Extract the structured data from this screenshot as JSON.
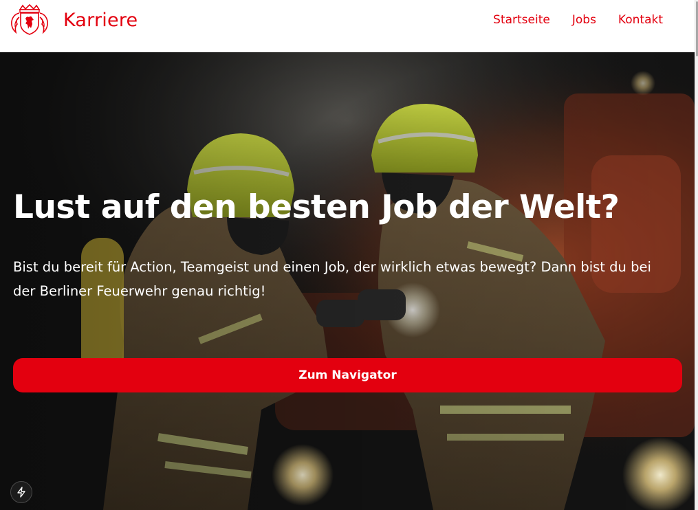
{
  "header": {
    "brand": "Karriere",
    "nav": {
      "home": "Startseite",
      "jobs": "Jobs",
      "contact": "Kontakt"
    },
    "logo_icon": "berlin-bear-coat-of-arms-icon"
  },
  "hero": {
    "headline": "Lust auf den besten Job der Welt?",
    "subtext": "Bist du bereit für Action, Teamgeist und einen Job, der wirklich etwas bewegt? Dann bist du bei der Berliner Feuerwehr genau richtig!",
    "cta_label": "Zum Navigator",
    "background_image": "firefighters-with-helmets-and-flashlight-photo"
  },
  "floating": {
    "icon": "lightning-bolt-icon"
  },
  "colors": {
    "brand_red": "#e3000f",
    "header_bg": "#ffffff",
    "hero_text": "#ffffff"
  }
}
